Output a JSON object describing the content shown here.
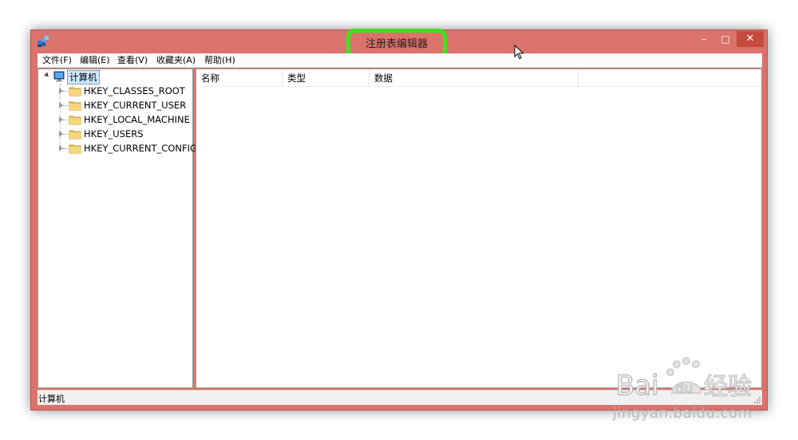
{
  "window": {
    "title": "注册表编辑器",
    "controls": {
      "minimize": "–",
      "maximize": "□",
      "close": "✕"
    },
    "frame_color": "#d9736b",
    "highlight_color": "#3fe21a"
  },
  "menubar": {
    "items": [
      {
        "label": "文件(F)"
      },
      {
        "label": "编辑(E)"
      },
      {
        "label": "查看(V)"
      },
      {
        "label": "收藏夹(A)"
      },
      {
        "label": "帮助(H)"
      }
    ]
  },
  "tree": {
    "root": {
      "label": "计算机",
      "icon": "computer-icon"
    },
    "children": [
      {
        "label": "HKEY_CLASSES_ROOT",
        "icon": "folder-icon"
      },
      {
        "label": "HKEY_CURRENT_USER",
        "icon": "folder-icon"
      },
      {
        "label": "HKEY_LOCAL_MACHINE",
        "icon": "folder-icon"
      },
      {
        "label": "HKEY_USERS",
        "icon": "folder-icon"
      },
      {
        "label": "HKEY_CURRENT_CONFIG",
        "icon": "folder-icon"
      }
    ]
  },
  "list": {
    "columns": [
      {
        "label": "名称"
      },
      {
        "label": "类型"
      },
      {
        "label": "数据"
      }
    ],
    "rows": []
  },
  "statusbar": {
    "text": "计算机"
  },
  "watermark": {
    "brand": "Bai du 经验",
    "url": "jingyan.baidu.com"
  }
}
